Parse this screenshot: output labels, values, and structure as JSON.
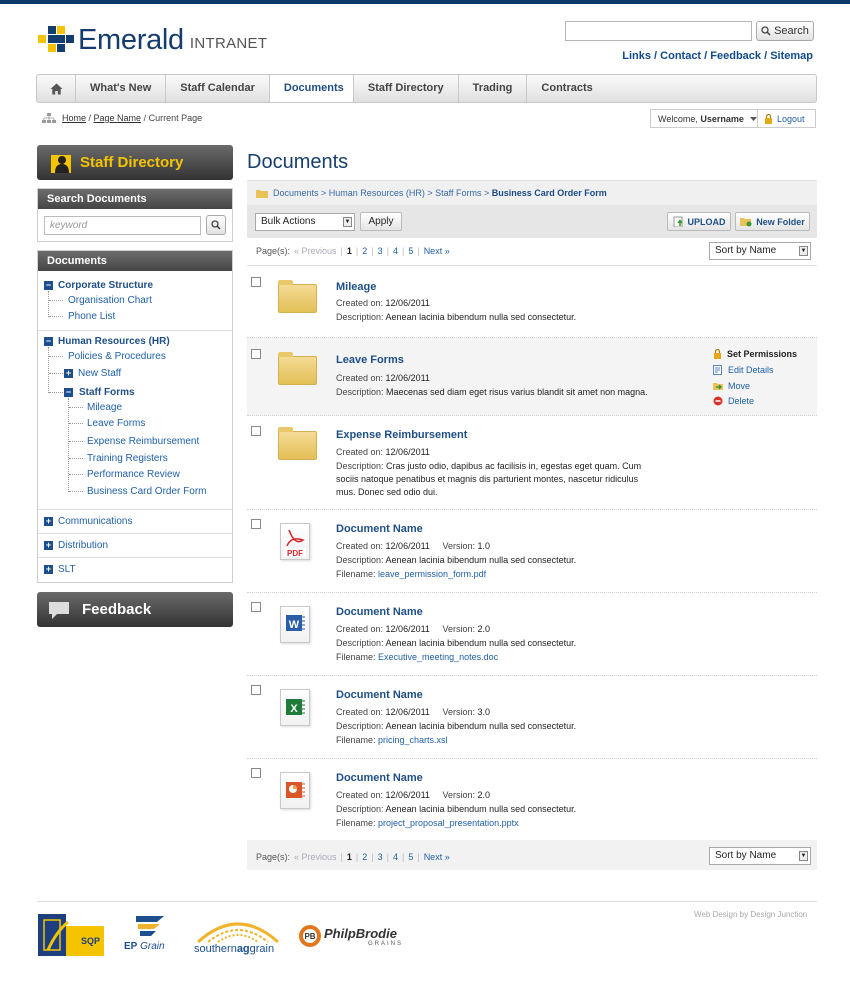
{
  "header": {
    "brand": "Emerald",
    "brand_sub": "INTRANET",
    "search_button": "Search",
    "links": [
      "Links",
      "Contact",
      "Feedback",
      "Sitemap"
    ]
  },
  "nav": {
    "items": [
      "What's New",
      "Staff Calendar",
      "Documents",
      "Staff Directory",
      "Trading",
      "Contracts"
    ],
    "active": "Documents"
  },
  "breadcrumb": {
    "home": "Home",
    "parent": "Page Name",
    "current": "Current Page"
  },
  "user": {
    "welcome": "Welcome,",
    "username": "Username",
    "logout": "Logout"
  },
  "sidebar": {
    "staff_directory": "Staff Directory",
    "search_title": "Search Documents",
    "search_placeholder": "keyword",
    "docs_title": "Documents",
    "corporate": "Corporate Structure",
    "org_chart": "Organisation Chart",
    "phone_list": "Phone List",
    "hr": "Human Resources (HR)",
    "policies": "Policies & Procedures",
    "new_staff": "New Staff",
    "staff_forms": "Staff Forms",
    "forms": [
      "Mileage",
      "Leave Forms",
      "Expense Reimbursement",
      "Training Registers",
      "Performance Review",
      "Business Card Order Form"
    ],
    "communications": "Communications",
    "distribution": "Distribution",
    "slt": "SLT",
    "feedback": "Feedback"
  },
  "main": {
    "title": "Documents",
    "path": [
      "Documents",
      "Human Resources (HR)",
      "Staff Forms"
    ],
    "path_current": "Business Card Order Form",
    "bulk": "Bulk Actions",
    "apply": "Apply",
    "upload": "UPLOAD",
    "new_folder": "New Folder",
    "pager": {
      "label": "Page(s):",
      "prev": "Previous",
      "pages": [
        "1",
        "2",
        "3",
        "4",
        "5"
      ],
      "next": "Next"
    },
    "sort": "Sort by Name",
    "created_label": "Created on:",
    "desc_label": "Description:",
    "version_label": "Version:",
    "filename_label": "Filename:",
    "folders": [
      {
        "name": "Mileage",
        "created": "12/06/2011",
        "desc": "Aenean lacinia bibendum nulla sed consectetur."
      },
      {
        "name": "Leave Forms",
        "created": "12/06/2011",
        "desc": "Maecenas sed diam eget risus varius blandit sit amet non magna."
      },
      {
        "name": "Expense Reimbursement",
        "created": "12/06/2011",
        "desc": "Cras justo odio, dapibus ac facilisis in, egestas eget quam. Cum sociis natoque penatibus et magnis dis parturient montes, nascetur ridiculus mus. Donec sed odio dui."
      }
    ],
    "actions": [
      "Set Permissions",
      "Edit Details",
      "Move",
      "Delete"
    ],
    "documents": [
      {
        "name": "Document Name",
        "created": "12/06/2011",
        "version": "1.0",
        "desc": "Aenean lacinia bibendum nulla sed consectetur.",
        "file": "leave_permission_form.pdf",
        "icon": "pdf-icon"
      },
      {
        "name": "Document Name",
        "created": "12/06/2011",
        "version": "2.0",
        "desc": "Aenean lacinia bibendum nulla sed consectetur.",
        "file": "Executive_meeting_notes.doc",
        "icon": "word-icon"
      },
      {
        "name": "Document Name",
        "created": "12/06/2011",
        "version": "3.0",
        "desc": "Aenean lacinia bibendum nulla sed consectetur.",
        "file": "pricing_charts.xsl",
        "icon": "excel-icon"
      },
      {
        "name": "Document Name",
        "created": "12/06/2011",
        "version": "2.0",
        "desc": "Aenean lacinia bibendum nulla sed consectetur.",
        "file": "project_proposal_presentation.pptx",
        "icon": "powerpoint-icon"
      }
    ]
  },
  "footer": {
    "credit": "Web Design by Design Junction",
    "logos": [
      "SQP",
      "EP",
      "Grain",
      "southern",
      "ag",
      "grain",
      "Philp",
      "Brodie",
      "GRAINS"
    ]
  },
  "colors": {
    "brand": "#153c6e",
    "accent": "#f5c400",
    "link": "#1f5fa5",
    "pdf": "#d7262c",
    "word": "#2b5ea8",
    "excel": "#1e7b3a",
    "powerpoint": "#d9562a"
  }
}
